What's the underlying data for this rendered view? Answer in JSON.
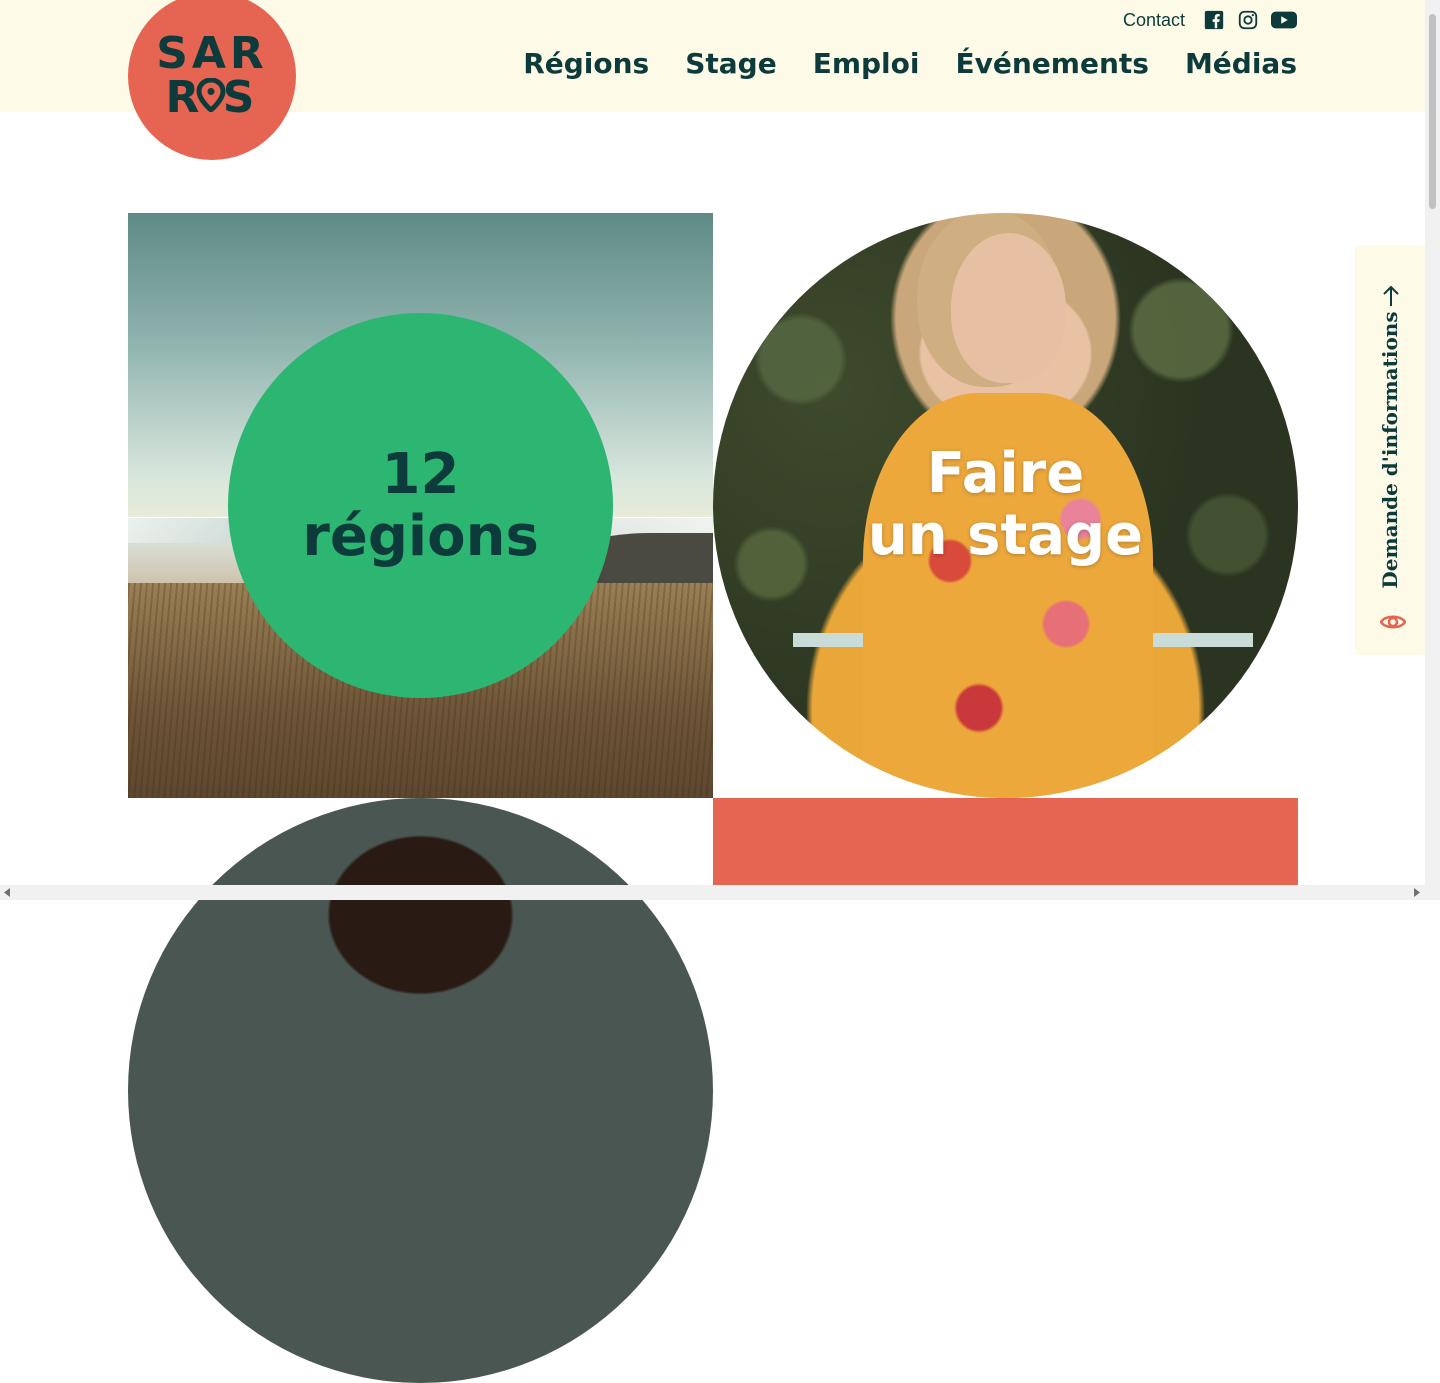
{
  "brand": {
    "logo_line1": "SAR",
    "logo_line2": "R S",
    "logo_color": "#e66452",
    "text_color": "#0d3b3b"
  },
  "header": {
    "contact_label": "Contact",
    "social": [
      "facebook-icon",
      "instagram-icon",
      "youtube-icon"
    ],
    "nav": [
      "Régions",
      "Stage",
      "Emploi",
      "Événements",
      "Médias"
    ],
    "background": "#fdfbe8"
  },
  "tiles": {
    "regions": {
      "line1": "12",
      "line2": "régions",
      "circle_color": "#2cb672"
    },
    "stage": {
      "line1": "Faire",
      "line2": "un stage"
    },
    "coral_color": "#e66452"
  },
  "side_tab": {
    "label": "Demande d'informations",
    "icons": [
      "arrow-up-icon",
      "eye-icon"
    ]
  }
}
